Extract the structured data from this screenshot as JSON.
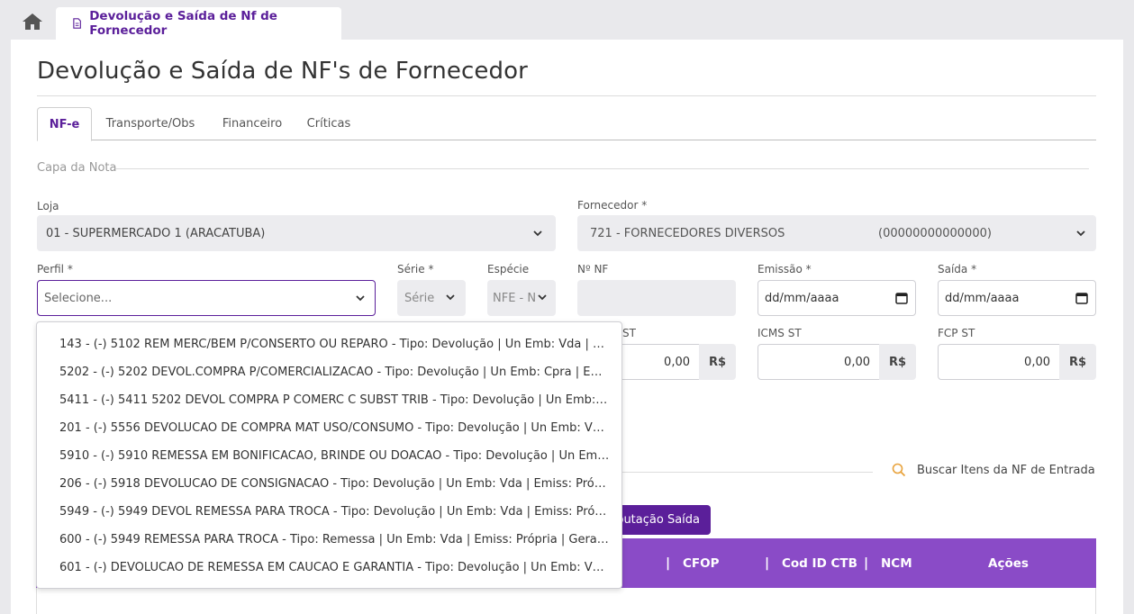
{
  "top_tab": {
    "label": "Devolução e Saída de Nf de Fornecedor"
  },
  "page_title": "Devolução e Saída de NF's de Fornecedor",
  "tabs": [
    {
      "label": "NF-e",
      "active": true
    },
    {
      "label": "Transporte/Obs"
    },
    {
      "label": "Financeiro"
    },
    {
      "label": "Críticas"
    }
  ],
  "section_title": "Capa da Nota",
  "loja": {
    "label": "Loja",
    "value": "01 - SUPERMERCADO 1 (ARACATUBA)"
  },
  "fornecedor": {
    "label": "Fornecedor *",
    "name": "721 - FORNECEDORES DIVERSOS",
    "doc": "(00000000000000)"
  },
  "perfil": {
    "label": "Perfil *",
    "placeholder": "Selecione..."
  },
  "serie": {
    "label": "Série *",
    "value": "Série"
  },
  "especie": {
    "label": "Espécie",
    "value": "NFE - N"
  },
  "nf": {
    "label": "Nº NF",
    "value": ""
  },
  "emissao": {
    "label": "Emissão *",
    "value": "dd/mm/aaaa"
  },
  "saida": {
    "label": "Saída *",
    "value": "dd/mm/aaaa"
  },
  "st_partial": {
    "label": "ST",
    "value": "0,00",
    "unit": "R$"
  },
  "icms_st": {
    "label": "ICMS ST",
    "value": "0,00",
    "unit": "R$"
  },
  "fcp_st": {
    "label": "FCP ST",
    "value": "0,00",
    "unit": "R$"
  },
  "buscar_itens": "Buscar Itens da NF de Entrada",
  "tributacao_button": "ibutação Saída",
  "table_headers": {
    "sep1": "|",
    "cfop": "CFOP",
    "sep2": "|",
    "cod_id_ctb": "Cod ID CTB",
    "sep3": "|",
    "ncm": "NCM",
    "acoes": "Ações"
  },
  "perfil_options": [
    "143 - (-) 5102 REM MERC/BEM P/CONSERTO OU REPARO - Tipo: Devolução | Un Emb: Vda | Emiss...",
    "5202 - (-) 5202 DEVOL.COMPRA P/COMERCIALIZACAO - Tipo: Devolução | Un Emb: Cpra | Emiss...",
    "5411 - (-) 5411 5202 DEVOL COMPRA P COMERC C SUBST TRIB - Tipo: Devolução | Un Emb: Cpra ...",
    "201 - (-) 5556 DEVOLUCAO DE COMPRA MAT USO/CONSUMO - Tipo: Devolução | Un Emb: Vda |...",
    "5910 - (-) 5910 REMESSA EM BONIFICACAO, BRINDE OU DOACAO - Tipo: Devolução | Un Emb: V...",
    "206 - (-) 5918 DEVOLUCAO DE CONSIGNACAO - Tipo: Devolução | Un Emb: Vda | Emiss: Própria ...",
    "5949 - (-) 5949 DEVOL REMESSA PARA TROCA - Tipo: Devolução | Un Emb: Vda | Emiss: Própria | ...",
    "600 - (-) 5949 REMESSA PARA TROCA - Tipo: Remessa | Un Emb: Vda | Emiss: Própria | Gera Fin: ...",
    "601 - (-) DEVOLUCAO DE REMESSA EM CAUCAO E GARANTIA - Tipo: Devolução | Un Emb: Vda | ..."
  ],
  "colors": {
    "accent": "#5b1f9a",
    "table_header": "#8a4bc7",
    "field_bg": "#ececef"
  }
}
